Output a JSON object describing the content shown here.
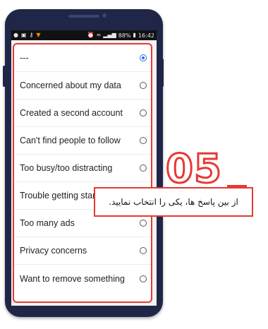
{
  "statusbar": {
    "battery_text": "88%",
    "time": "16:42"
  },
  "dialog": {
    "options": [
      {
        "label": "---",
        "checked": true
      },
      {
        "label": "Concerned about my data",
        "checked": false
      },
      {
        "label": "Created a second account",
        "checked": false
      },
      {
        "label": "Can't find people to follow",
        "checked": false
      },
      {
        "label": "Too busy/too distracting",
        "checked": false
      },
      {
        "label": "Trouble getting started",
        "checked": false
      },
      {
        "label": "Too many ads",
        "checked": false
      },
      {
        "label": "Privacy concerns",
        "checked": false
      },
      {
        "label": "Want to remove something",
        "checked": false
      }
    ]
  },
  "callout": {
    "number": "05",
    "text": "از بین پاسخ ها، یکی را انتخاب نمایید."
  },
  "colors": {
    "accent": "#e53935",
    "radio_selected": "#1a73e8",
    "phone_body": "#1f2647"
  }
}
